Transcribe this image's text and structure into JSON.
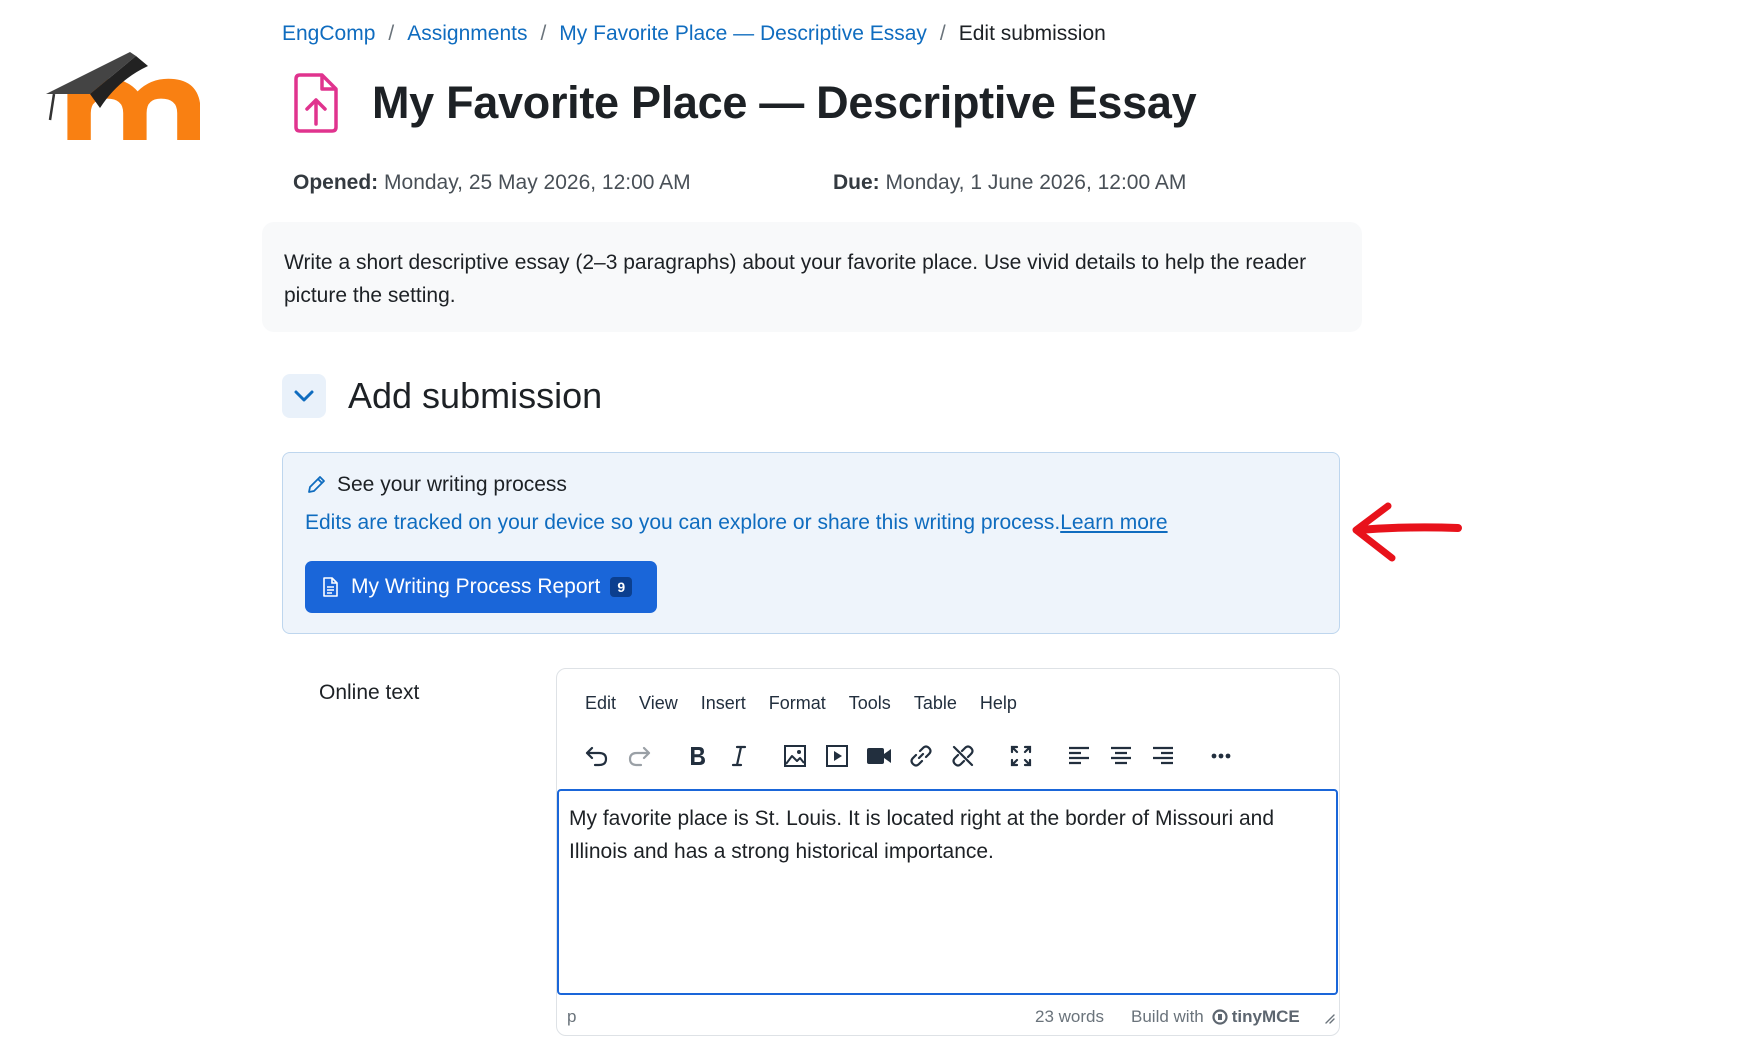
{
  "breadcrumb": [
    {
      "label": "EngComp",
      "link": true
    },
    {
      "label": "Assignments",
      "link": true
    },
    {
      "label": "My Favorite Place — Descriptive Essay",
      "link": true
    },
    {
      "label": "Edit submission",
      "link": false
    }
  ],
  "title": "My Favorite Place — Descriptive Essay",
  "dates": {
    "opened_label": "Opened:",
    "opened_value": "Monday, 25 May 2026, 12:00 AM",
    "due_label": "Due:",
    "due_value": "Monday, 1 June 2026, 12:00 AM"
  },
  "intro": "Write a short descriptive essay (2–3 paragraphs) about your favorite place. Use vivid details to help the reader picture the setting.",
  "section": {
    "title": "Add submission"
  },
  "writing_process": {
    "heading": "See your writing process",
    "description": "Edits are tracked on your device so you can explore or share this writing process.",
    "learn_more": "Learn more",
    "report_button": "My Writing Process Report",
    "report_count": "9"
  },
  "online_text_label": "Online text",
  "editor": {
    "menu": [
      "Edit",
      "View",
      "Insert",
      "Format",
      "Tools",
      "Table",
      "Help"
    ],
    "toolbar_icons": [
      "undo-icon",
      "redo-icon",
      "bold-icon",
      "italic-icon",
      "image-icon",
      "media-icon",
      "video-icon",
      "link-icon",
      "unlink-icon",
      "fullscreen-icon",
      "align-left-icon",
      "align-center-icon",
      "align-right-icon",
      "more-icon"
    ],
    "content": "My favorite place is St. Louis. It is located right at the border of Missouri and Illinois and has a strong historical importance.",
    "status_path": "p",
    "word_count": "23 words",
    "build_with": "Build with",
    "brand": "tinyMCE"
  },
  "colors": {
    "link": "#0f6cbf",
    "primary_button": "#1a66d9",
    "logo_orange": "#f98012",
    "assignment_icon": "#e0338e",
    "annotation_arrow": "#e8121b"
  }
}
